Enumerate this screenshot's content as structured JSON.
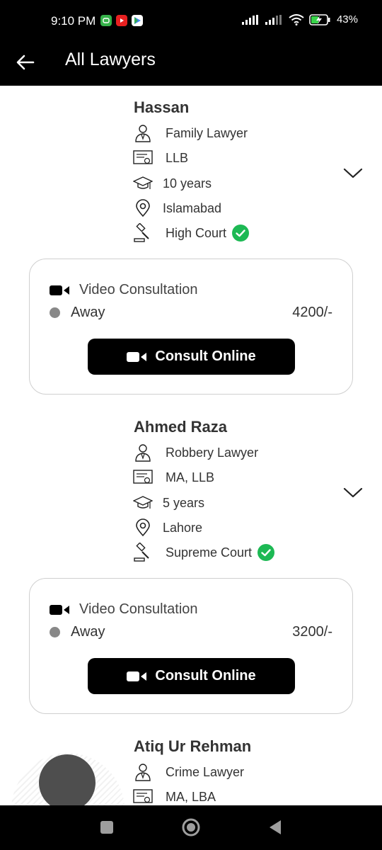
{
  "status_bar": {
    "time": "9:10 PM",
    "battery": "43%",
    "notification_icons": [
      "messaging-icon",
      "youtube-icon",
      "play-store-icon"
    ]
  },
  "app_bar": {
    "title": "All Lawyers",
    "back_icon": "arrow-left-icon"
  },
  "lawyers": [
    {
      "name": "Hassan",
      "specialty": "Family Lawyer",
      "degree": "LLB",
      "experience": "10 years",
      "city": "Islamabad",
      "court": "High Court",
      "verified": true,
      "consultation": {
        "type": "Video Consultation",
        "status": "Away",
        "fee": "4200/-",
        "button": "Consult Online"
      }
    },
    {
      "name": "Ahmed Raza",
      "specialty": "Robbery Lawyer",
      "degree": "MA, LLB",
      "experience": "5 years",
      "city": "Lahore",
      "court": "Supreme Court",
      "verified": true,
      "consultation": {
        "type": "Video Consultation",
        "status": "Away",
        "fee": "3200/-",
        "button": "Consult Online"
      }
    },
    {
      "name": "Atiq Ur Rehman",
      "specialty": "Crime Lawyer",
      "degree": "MA, LBA"
    }
  ],
  "colors": {
    "bars": "#000000",
    "verified": "#1db954",
    "away_dot": "#888888",
    "card_border": "#cfcfcf"
  },
  "nav": [
    "recents-square-icon",
    "home-circle-icon",
    "back-triangle-icon"
  ]
}
